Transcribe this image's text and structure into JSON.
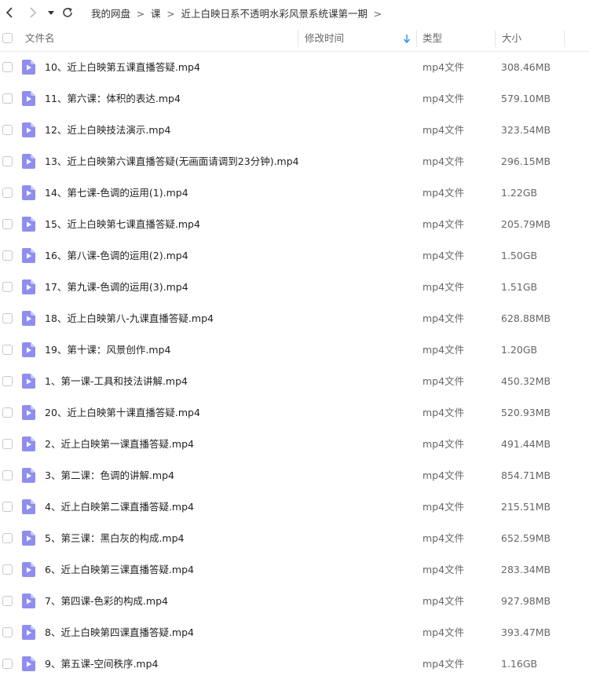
{
  "nav": {
    "breadcrumbs": [
      "我的网盘",
      "课",
      "近上白映日系不透明水彩风景系统课第一期"
    ]
  },
  "table": {
    "columns": {
      "name": "文件名",
      "modified": "修改时间",
      "type": "类型",
      "size": "大小"
    },
    "sort": "modified-descending",
    "rows": [
      {
        "name": "10、近上白映第五课直播答疑.mp4",
        "type": "mp4文件",
        "size": "308.46MB"
      },
      {
        "name": "11、第六课：体积的表达.mp4",
        "type": "mp4文件",
        "size": "579.10MB"
      },
      {
        "name": "12、近上白映技法演示.mp4",
        "type": "mp4文件",
        "size": "323.54MB"
      },
      {
        "name": "13、近上白映第六课直播答疑(无画面请调到23分钟).mp4",
        "type": "mp4文件",
        "size": "296.15MB"
      },
      {
        "name": "14、第七课-色调的运用(1).mp4",
        "type": "mp4文件",
        "size": "1.22GB"
      },
      {
        "name": "15、近上白映第七课直播答疑.mp4",
        "type": "mp4文件",
        "size": "205.79MB"
      },
      {
        "name": "16、第八课-色调的运用(2).mp4",
        "type": "mp4文件",
        "size": "1.50GB"
      },
      {
        "name": "17、第九课-色调的运用(3).mp4",
        "type": "mp4文件",
        "size": "1.51GB"
      },
      {
        "name": "18、近上白映第八-九课直播答疑.mp4",
        "type": "mp4文件",
        "size": "628.88MB"
      },
      {
        "name": "19、第十课：风景创作.mp4",
        "type": "mp4文件",
        "size": "1.20GB"
      },
      {
        "name": "1、第一课-工具和技法讲解.mp4",
        "type": "mp4文件",
        "size": "450.32MB"
      },
      {
        "name": "20、近上白映第十课直播答疑.mp4",
        "type": "mp4文件",
        "size": "520.93MB"
      },
      {
        "name": "2、近上白映第一课直播答疑.mp4",
        "type": "mp4文件",
        "size": "491.44MB"
      },
      {
        "name": "3、第二课：色调的讲解.mp4",
        "type": "mp4文件",
        "size": "854.71MB"
      },
      {
        "name": "4、近上白映第二课直播答疑.mp4",
        "type": "mp4文件",
        "size": "215.51MB"
      },
      {
        "name": "5、第三课：黑白灰的构成.mp4",
        "type": "mp4文件",
        "size": "652.59MB"
      },
      {
        "name": "6、近上白映第三课直播答疑.mp4",
        "type": "mp4文件",
        "size": "283.34MB"
      },
      {
        "name": "7、第四课-色彩的构成.mp4",
        "type": "mp4文件",
        "size": "927.98MB"
      },
      {
        "name": "8、近上白映第四课直播答疑.mp4",
        "type": "mp4文件",
        "size": "393.47MB"
      },
      {
        "name": "9、第五课-空间秩序.mp4",
        "type": "mp4文件",
        "size": "1.16GB"
      }
    ]
  },
  "colors": {
    "video_icon": "#8f8ef0",
    "sort_arrow": "#2b8cf7"
  }
}
